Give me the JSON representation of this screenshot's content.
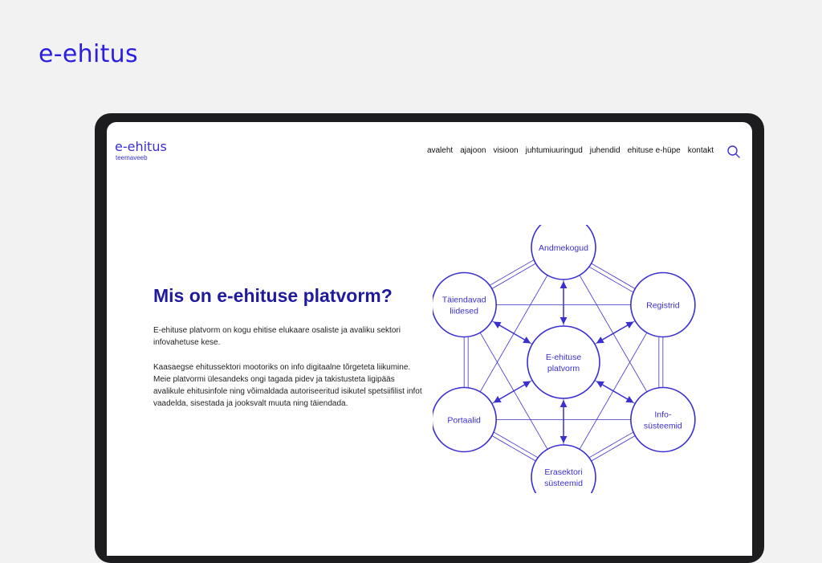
{
  "brand": {
    "logo_text": "e-ehitus"
  },
  "site": {
    "logo_name": "e-ehitus",
    "logo_sub": "teemaveeb",
    "nav": [
      "avaleht",
      "ajajoon",
      "visioon",
      "juhtumiuuringud",
      "juhendid",
      "ehituse e-hüpe",
      "kontakt"
    ]
  },
  "hero": {
    "title": "Mis on e-ehituse platvorm?",
    "paragraph1": "E-ehituse platvorm on kogu ehitise elukaare osaliste ja avaliku sektori infovahetuse kese.",
    "paragraph2": "Kaasaegse ehitussektori mootoriks on info digitaalne tõrgeteta liikumine. Meie platvormi ülesandeks ongi tagada pidev ja takistusteta ligipääs avalikule ehitusinfole ning võimaldada autoriseeritud isikutel spetsiifilist infot vaadelda, sisestada ja jooksvalt muuta ning täiendada."
  },
  "diagram": {
    "center": {
      "line1": "E-ehituse",
      "line2": "platvorm"
    },
    "nodes": [
      {
        "id": "andmekogud",
        "line1": "Andmekogud",
        "line2": ""
      },
      {
        "id": "registrid",
        "line1": "Registrid",
        "line2": ""
      },
      {
        "id": "infosusteemid",
        "line1": "Info-",
        "line2": "süsteemid"
      },
      {
        "id": "erasektori",
        "line1": "Erasektori",
        "line2": "süsteemid"
      },
      {
        "id": "portaalid",
        "line1": "Portaalid",
        "line2": ""
      },
      {
        "id": "taiendavad",
        "line1": "Täiendavad",
        "line2": "liidesed"
      }
    ],
    "stroke_color": "#3a2fd0"
  },
  "colors": {
    "brand": "#2b1ee0",
    "title": "#1f1a9e",
    "accent": "#3a2fd0"
  },
  "icons": {
    "search": "search-icon"
  }
}
